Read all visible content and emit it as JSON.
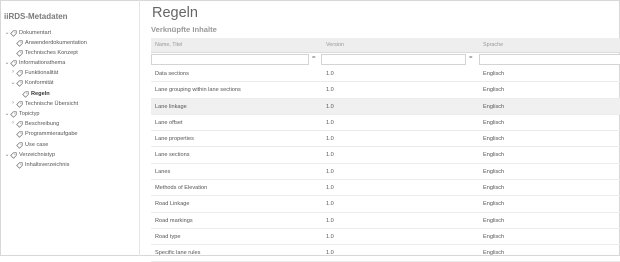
{
  "sidebar": {
    "title": "iiRDS-Metadaten",
    "items": [
      {
        "label": "Dokumentart",
        "depth": 0,
        "arrow": "expanded",
        "bold": false
      },
      {
        "label": "Anwenderdokumentation",
        "depth": 1,
        "arrow": "none",
        "bold": false
      },
      {
        "label": "Technisches Konzept",
        "depth": 1,
        "arrow": "none",
        "bold": false
      },
      {
        "label": "Informationsthema",
        "depth": 0,
        "arrow": "expanded",
        "bold": false
      },
      {
        "label": "Funktionalität",
        "depth": 1,
        "arrow": "collapsed",
        "bold": false
      },
      {
        "label": "Konformität",
        "depth": 1,
        "arrow": "expanded",
        "bold": false
      },
      {
        "label": "Regeln",
        "depth": 2,
        "arrow": "none",
        "bold": true
      },
      {
        "label": "Technische Übersicht",
        "depth": 1,
        "arrow": "collapsed",
        "bold": false
      },
      {
        "label": "Topictyp",
        "depth": 0,
        "arrow": "expanded",
        "bold": false
      },
      {
        "label": "Beschreibung",
        "depth": 1,
        "arrow": "collapsed",
        "bold": false
      },
      {
        "label": "Programmieraufgabe",
        "depth": 1,
        "arrow": "none",
        "bold": false
      },
      {
        "label": "Use case",
        "depth": 1,
        "arrow": "none",
        "bold": false
      },
      {
        "label": "Verzeichnistyp",
        "depth": 0,
        "arrow": "expanded",
        "bold": false
      },
      {
        "label": "Inhaltsverzeichnis",
        "depth": 1,
        "arrow": "none",
        "bold": false
      }
    ]
  },
  "main": {
    "title": "Regeln",
    "subtitle": "Verknüpfte Inhalte",
    "columns": [
      "Name, Titel",
      "Version",
      "Sprache"
    ],
    "filter_symbol": "=",
    "rows": [
      {
        "name": "Data sections",
        "version": "1.0",
        "language": "Englisch",
        "selected": false
      },
      {
        "name": "Lane grouping within lane sections",
        "version": "1.0",
        "language": "Englisch",
        "selected": false
      },
      {
        "name": "Lane linkage",
        "version": "1.0",
        "language": "Englisch",
        "selected": true
      },
      {
        "name": "Lane offset",
        "version": "1.0",
        "language": "Englisch",
        "selected": false
      },
      {
        "name": "Lane properties",
        "version": "1.0",
        "language": "Englisch",
        "selected": false
      },
      {
        "name": "Lane sections",
        "version": "1.0",
        "language": "Englisch",
        "selected": false
      },
      {
        "name": "Lanes",
        "version": "1.0",
        "language": "Englisch",
        "selected": false
      },
      {
        "name": "Methods of Elevation",
        "version": "1.0",
        "language": "Englisch",
        "selected": false
      },
      {
        "name": "Road Linkage",
        "version": "1.0",
        "language": "Englisch",
        "selected": false
      },
      {
        "name": "Road markings",
        "version": "1.0",
        "language": "Englisch",
        "selected": false
      },
      {
        "name": "Road type",
        "version": "1.0",
        "language": "Englisch",
        "selected": false
      },
      {
        "name": "Specific lane rules",
        "version": "1.0",
        "language": "Englisch",
        "selected": false
      }
    ]
  },
  "colors": {
    "tag_stroke": "#777777",
    "selected_row": "#f0f0f0",
    "header_bg": "#eeeeee"
  },
  "icons": {
    "expanded": "chevron-down-icon",
    "collapsed": "chevron-right-icon",
    "item": "tag-icon"
  }
}
